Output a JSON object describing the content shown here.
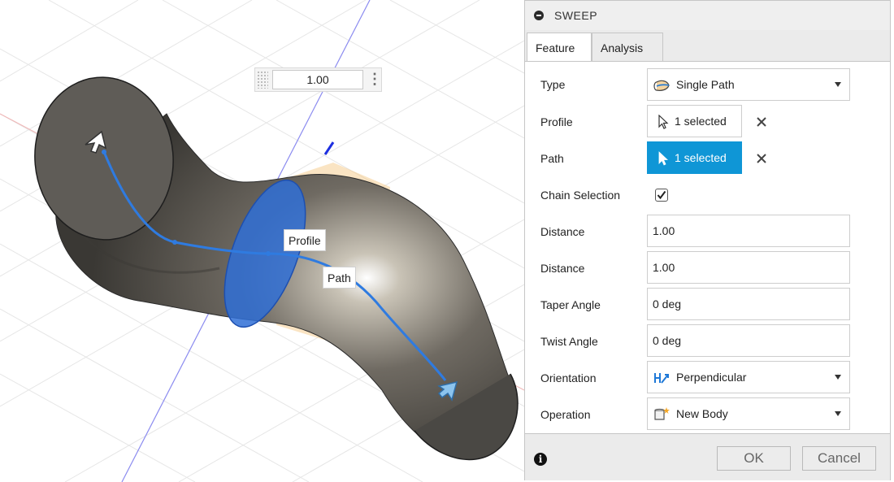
{
  "viewport": {
    "distance_value": "1.00",
    "label_profile": "Profile",
    "label_path": "Path"
  },
  "panel": {
    "title": "SWEEP",
    "tabs": [
      {
        "label": "Feature",
        "active": true
      },
      {
        "label": "Analysis",
        "active": false
      }
    ],
    "rows": {
      "type": {
        "label": "Type",
        "value": "Single Path",
        "icon": "single-path-icon"
      },
      "profile": {
        "label": "Profile",
        "value": "1 selected",
        "icon": "cursor-icon"
      },
      "path": {
        "label": "Path",
        "value": "1 selected",
        "icon": "cursor-icon"
      },
      "chain_selection": {
        "label": "Chain Selection",
        "checked": true
      },
      "distance1": {
        "label": "Distance",
        "value": "1.00"
      },
      "distance2": {
        "label": "Distance",
        "value": "1.00"
      },
      "taper_angle": {
        "label": "Taper Angle",
        "value": "0 deg"
      },
      "twist_angle": {
        "label": "Twist Angle",
        "value": "0 deg"
      },
      "orientation": {
        "label": "Orientation",
        "value": "Perpendicular",
        "icon": "perpendicular-icon"
      },
      "operation": {
        "label": "Operation",
        "value": "New Body",
        "icon": "new-body-icon"
      }
    },
    "footer": {
      "ok_label": "OK",
      "cancel_label": "Cancel"
    }
  },
  "colors": {
    "accent": "#0f96d6",
    "selection_blue": "#2f6fd6",
    "body_metal": "#5c5a55"
  }
}
